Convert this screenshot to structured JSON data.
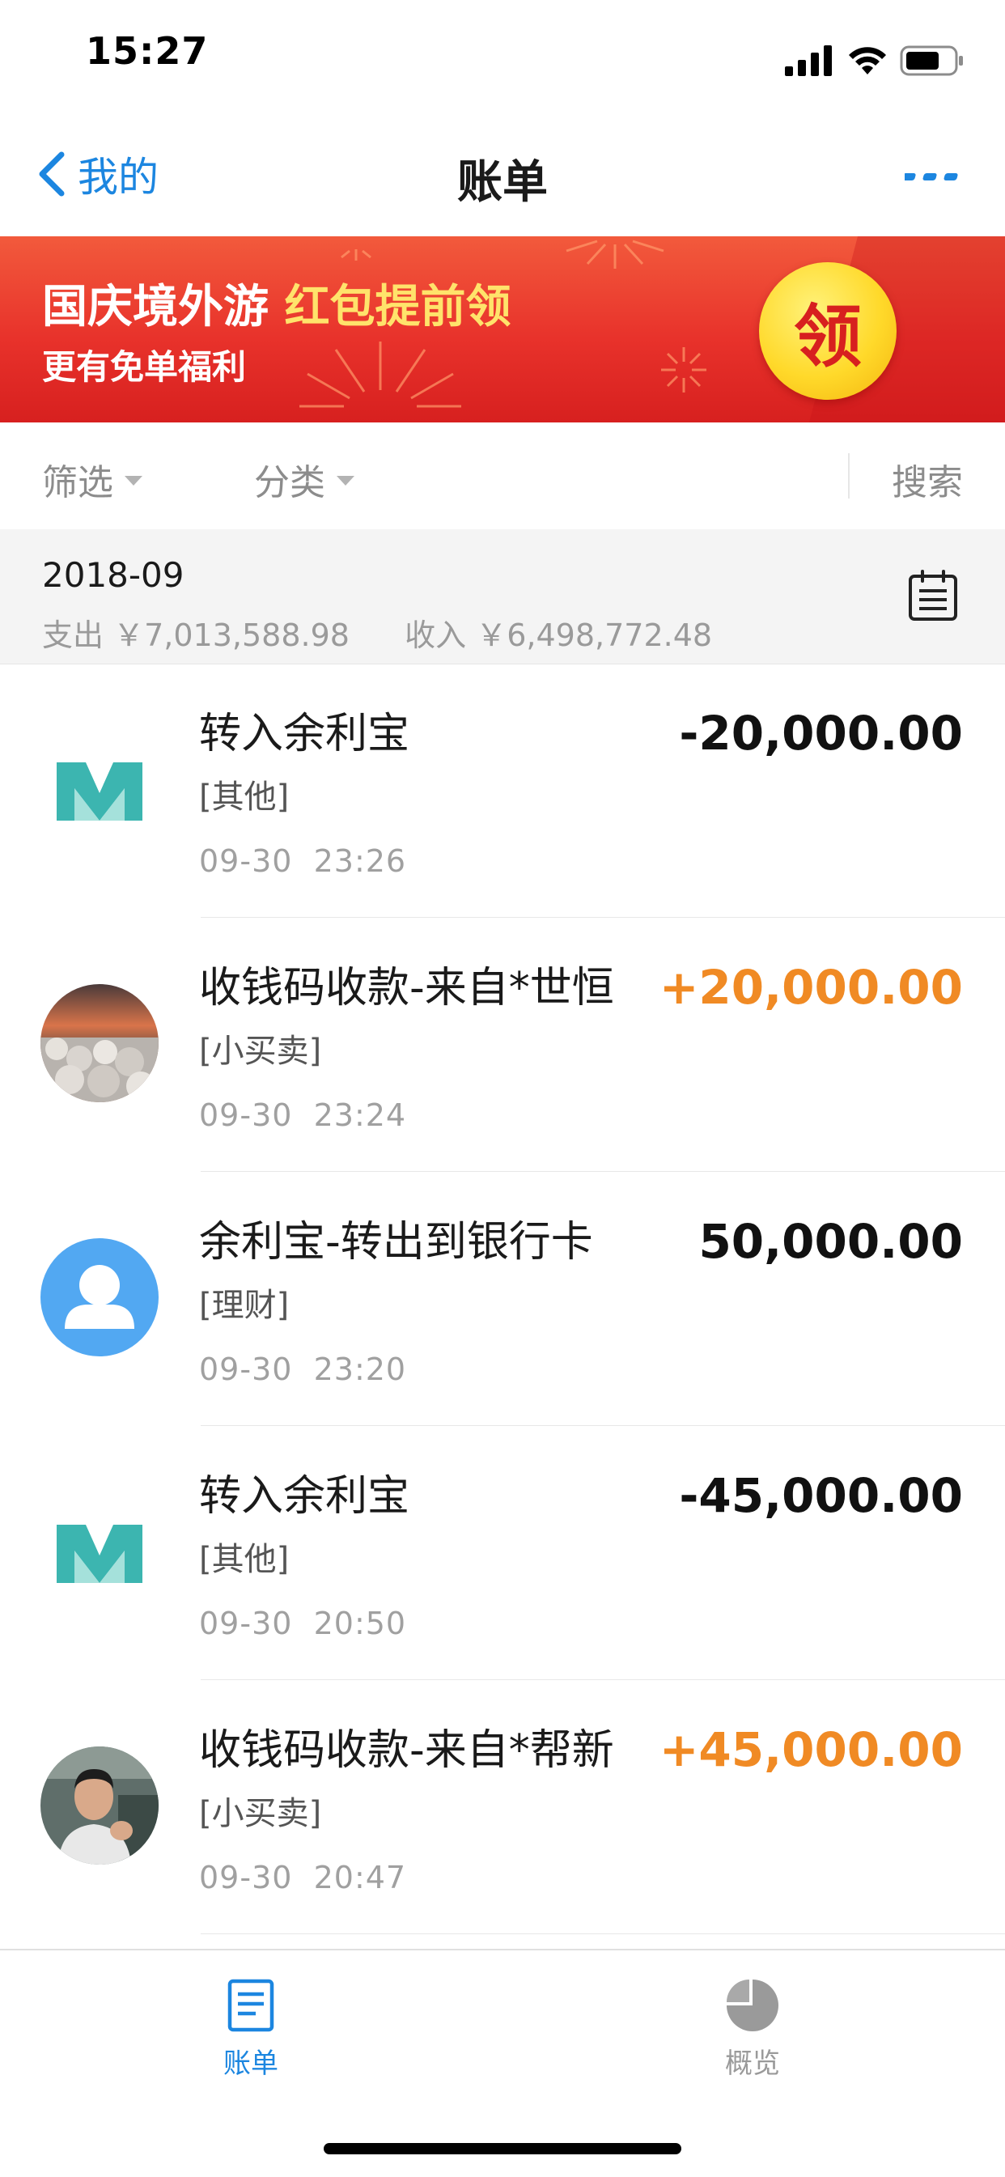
{
  "status_bar": {
    "time": "15:27"
  },
  "nav": {
    "back_label": "我的",
    "title": "账单"
  },
  "banner": {
    "line1_white": "国庆境外游",
    "line1_highlight": "红包提前领",
    "line2": "更有免单福利",
    "claim_label": "领"
  },
  "filters": {
    "filter_label": "筛选",
    "category_label": "分类",
    "search_label": "搜索"
  },
  "month": {
    "label": "2018-09",
    "expense_label": "支出",
    "expense_value": "￥7,013,588.98",
    "income_label": "收入",
    "income_value": "￥6,498,772.48"
  },
  "transactions": [
    {
      "title": "转入余利宝",
      "category": "[其他]",
      "date": "09-30",
      "time": "23:26",
      "amount": "-20,000.00",
      "type": "expense",
      "avatar": "mybank-logo-icon"
    },
    {
      "title": "收钱码收款-来自*世恒",
      "category": "[小买卖]",
      "date": "09-30",
      "time": "23:24",
      "amount": "+20,000.00",
      "type": "income",
      "avatar": "sunset-photo-avatar"
    },
    {
      "title": "余利宝-转出到银行卡",
      "category": "[理财]",
      "date": "09-30",
      "time": "23:20",
      "amount": "50,000.00",
      "type": "neutral",
      "avatar": "default-user-icon"
    },
    {
      "title": "转入余利宝",
      "category": "[其他]",
      "date": "09-30",
      "time": "20:50",
      "amount": "-45,000.00",
      "type": "expense",
      "avatar": "mybank-logo-icon"
    },
    {
      "title": "收钱码收款-来自*帮新",
      "category": "[小买卖]",
      "date": "09-30",
      "time": "20:47",
      "amount": "+45,000.00",
      "type": "income",
      "avatar": "person-photo-avatar"
    }
  ],
  "tabs": [
    {
      "label": "账单",
      "active": true
    },
    {
      "label": "概览",
      "active": false
    }
  ],
  "colors": {
    "accent": "#1c86e0",
    "income": "#f08a24",
    "banner_red": "#e8322b",
    "banner_highlight": "#ffe36b"
  }
}
